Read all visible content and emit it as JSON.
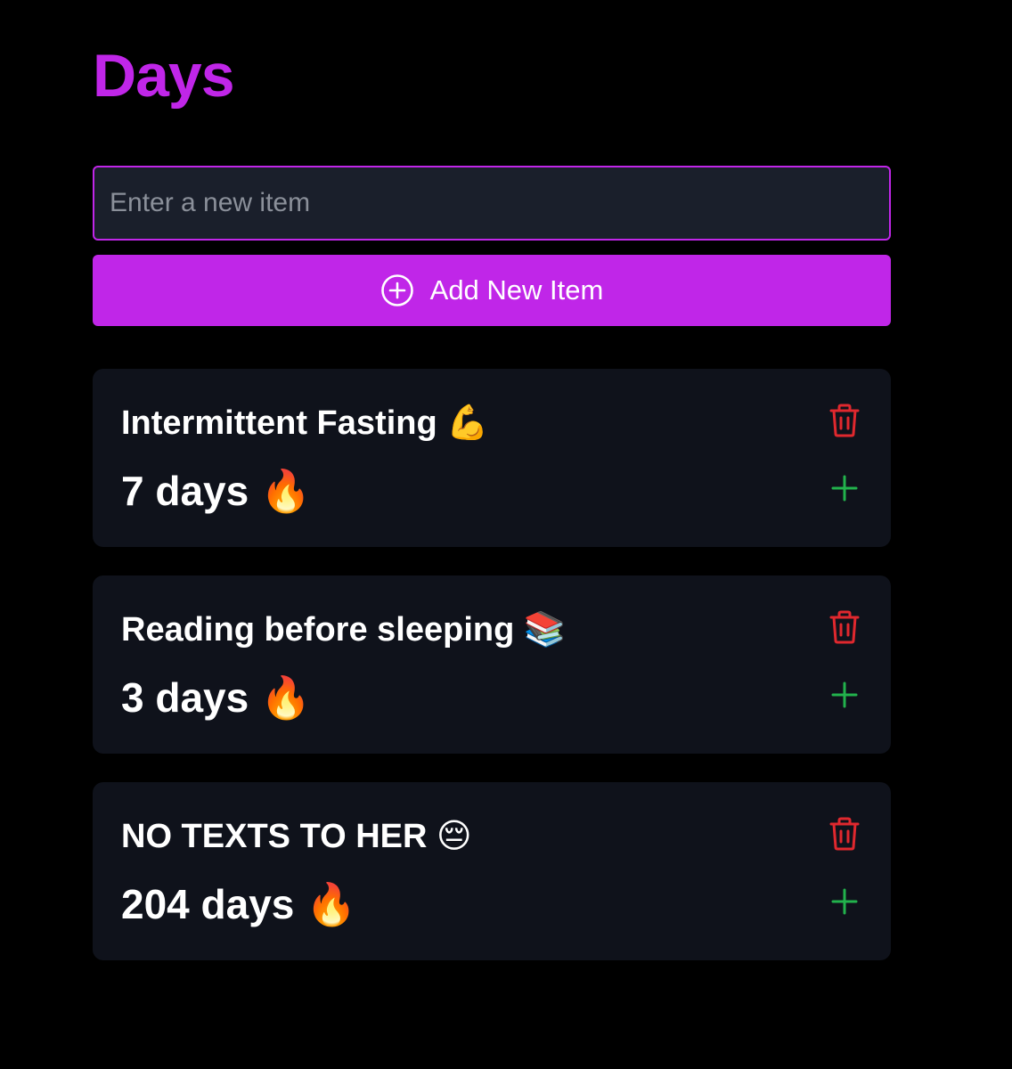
{
  "colors": {
    "accent": "#c026e8",
    "delete": "#e0282e",
    "increment": "#22b24c",
    "card_bg": "#0f121b",
    "input_bg": "#1a1f2b"
  },
  "header": {
    "title": "Days"
  },
  "new_item": {
    "placeholder": "Enter a new item",
    "value": "",
    "button_label": "Add New Item",
    "button_icon": "plus-circle-icon"
  },
  "items": [
    {
      "title": "Intermittent Fasting 💪",
      "count_label": "7 days 🔥",
      "delete_icon": "trash-icon",
      "increment_icon": "plus-icon"
    },
    {
      "title": "Reading before sleeping 📚",
      "count_label": "3 days 🔥",
      "delete_icon": "trash-icon",
      "increment_icon": "plus-icon"
    },
    {
      "title": "NO TEXTS TO HER 😔",
      "count_label": "204 days 🔥",
      "delete_icon": "trash-icon",
      "increment_icon": "plus-icon"
    }
  ]
}
